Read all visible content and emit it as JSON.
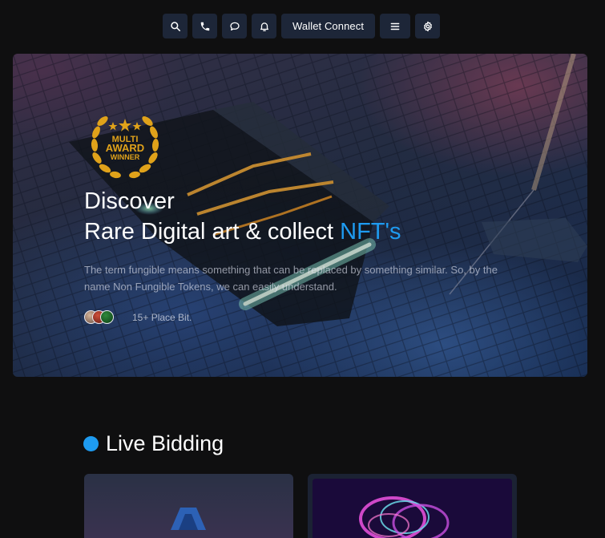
{
  "toolbar": {
    "icons": [
      "search-icon",
      "phone-icon",
      "chat-icon",
      "bell-icon",
      "menu-icon",
      "gear-icon"
    ],
    "wallet_label": "Wallet Connect",
    "button_bg": "#1d2638"
  },
  "hero": {
    "award": {
      "line1": "MULTI",
      "line2": "AWARD",
      "line3": "WINNER",
      "color": "#e0a21a"
    },
    "title_line1": "Discover",
    "title_line2_prefix": "Rare Digital art & collect ",
    "title_line2_accent": "NFT's",
    "accent_color": "#1e9bf0",
    "description": "The term fungible means something that can be replaced by something similar. So, by the name Non Fungible Tokens, we can easily understand.",
    "place_bit": "15+ Place Bit."
  },
  "live_bidding": {
    "title": "Live Bidding",
    "dot_color": "#1e9bf0"
  }
}
